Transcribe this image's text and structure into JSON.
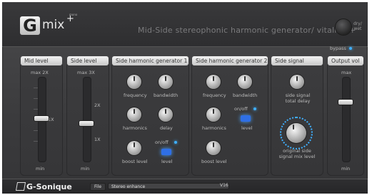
{
  "header": {
    "logo_letter": "G",
    "logo_text": "mix",
    "logo_plus": "+",
    "logo_tiny": "mono",
    "title": "Mid-Side stereophonic harmonic generator/ vitaliser+",
    "drywet_label_1": "dry/",
    "drywet_label_2": "wet"
  },
  "panels": {
    "mid_level": {
      "title": "Mid level",
      "top_label": "max 2X",
      "one_x": "1X",
      "bottom_label": "min"
    },
    "side_level": {
      "title": "Side level",
      "top_label": "max 3X",
      "two_x": "2X",
      "one_x": "1X",
      "bottom_label": "min"
    },
    "side_harm_1": {
      "title": "Side harmonic generator 1",
      "labels": [
        "frequency",
        "bandwidth",
        "harmonics",
        "delay",
        "boost level",
        "level"
      ],
      "onoff": "on/off"
    },
    "side_harm_2": {
      "title": "Side harmonic generator 2",
      "labels": [
        "frequency",
        "bandwidth",
        "harmonics",
        "level",
        "boost level"
      ],
      "onoff": "on/off"
    },
    "side_signal": {
      "title": "Side signal",
      "delay_label_1": "side signal",
      "delay_label_2": "total delay",
      "mix_label_1": "original side",
      "mix_label_2": "signal mix level"
    },
    "output": {
      "title": "Output vol",
      "bypass": "bypass",
      "top_label": "max",
      "bottom_label": "min"
    }
  },
  "footer": {
    "brand": "G-Sonique",
    "file_label": "File",
    "preset": "Stereo enhance",
    "version": "V16"
  },
  "colors": {
    "accent": "#3fb0ff",
    "button": "#2f6fe6"
  }
}
